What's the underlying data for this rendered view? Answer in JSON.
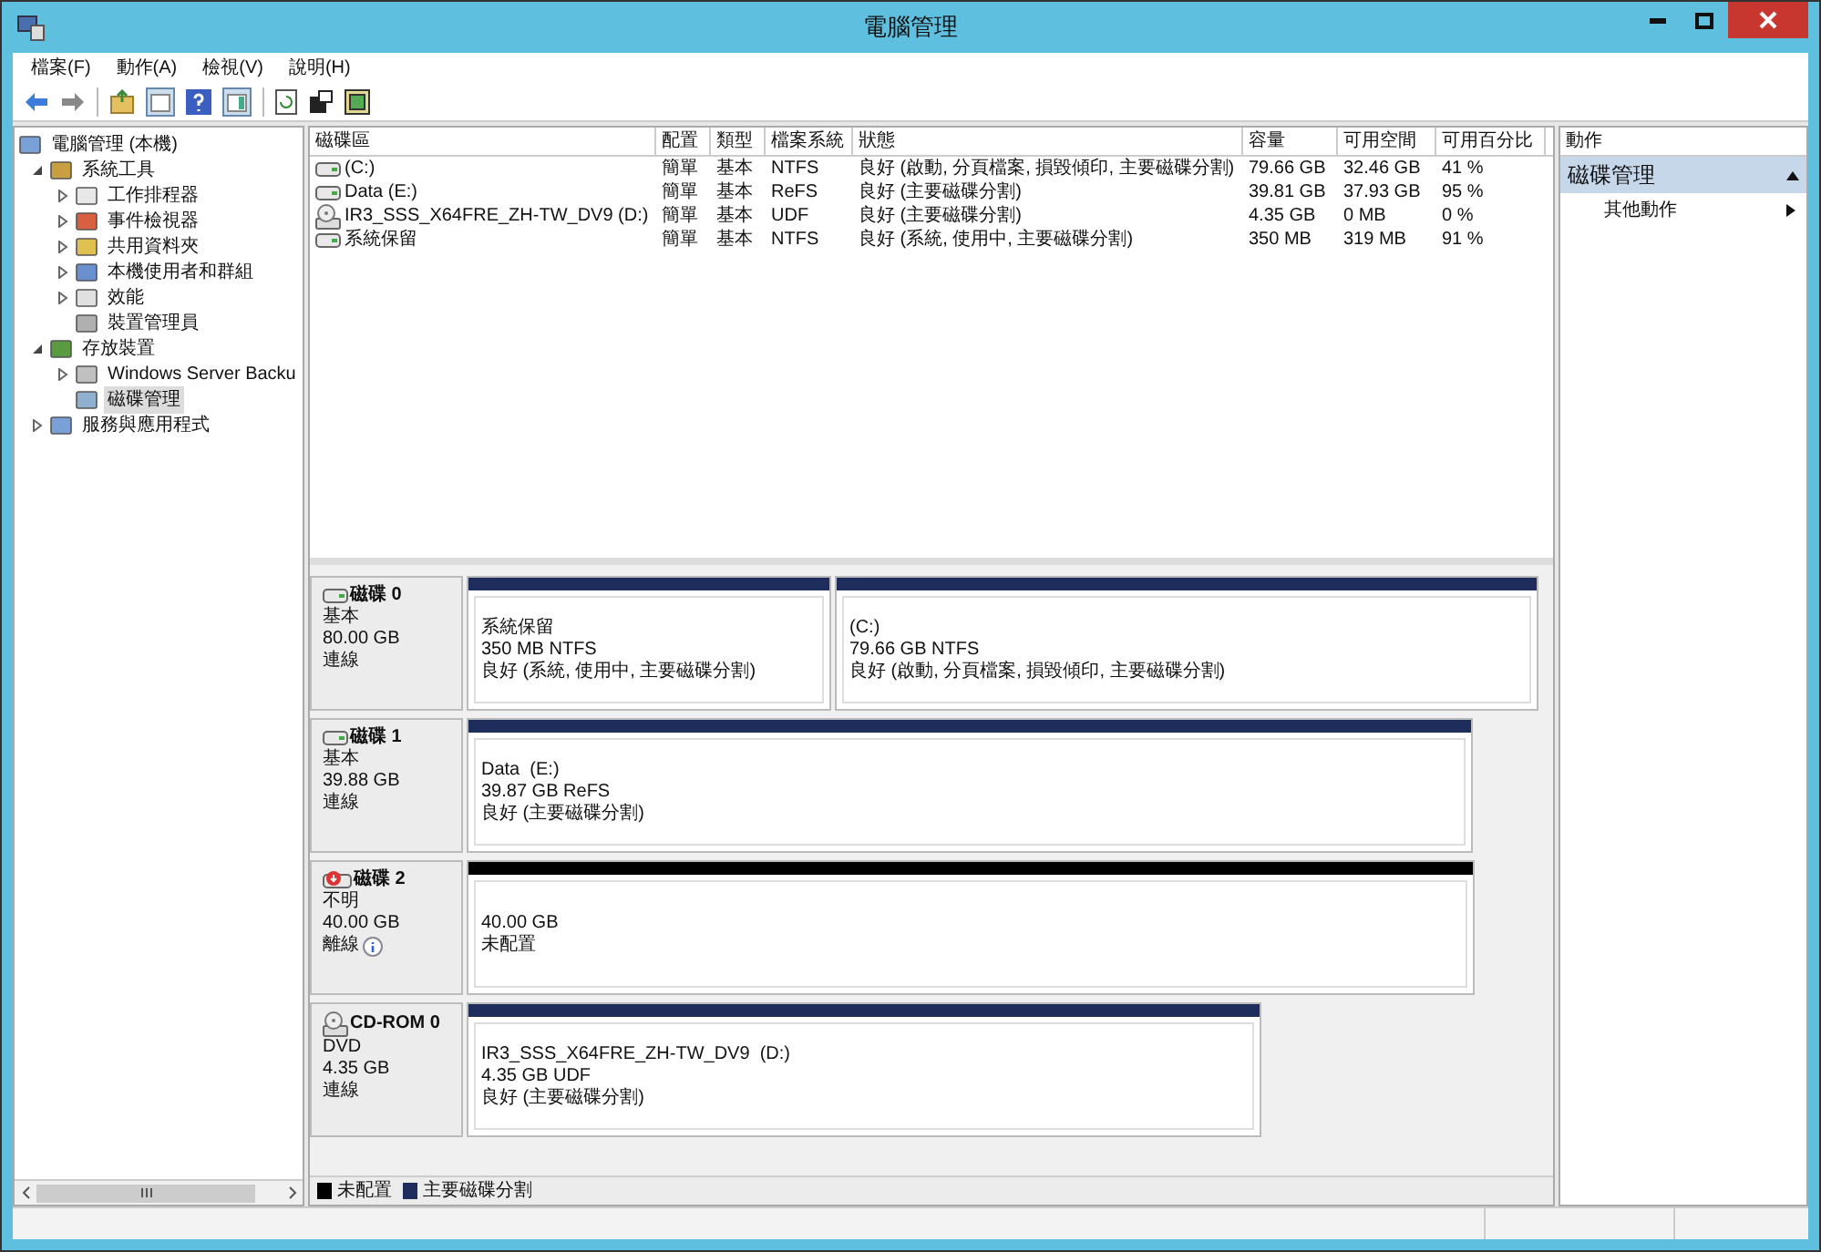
{
  "window": {
    "title": "電腦管理"
  },
  "menu": [
    "檔案(F)",
    "動作(A)",
    "檢視(V)",
    "說明(H)"
  ],
  "tree": [
    {
      "label": "電腦管理 (本機)",
      "selected": false,
      "children": [
        {
          "label": "系統工具",
          "selected": false,
          "expanded": true,
          "children": [
            {
              "label": "工作排程器",
              "selected": false,
              "expanded": false
            },
            {
              "label": "事件檢視器",
              "selected": false,
              "expanded": false
            },
            {
              "label": "共用資料夾",
              "selected": false,
              "expanded": false
            },
            {
              "label": "本機使用者和群組",
              "selected": false,
              "expanded": false
            },
            {
              "label": "效能",
              "selected": false,
              "expanded": false
            },
            {
              "label": "裝置管理員",
              "selected": false
            }
          ]
        },
        {
          "label": "存放裝置",
          "selected": false,
          "expanded": true,
          "children": [
            {
              "label": "Windows Server Backu",
              "selected": false,
              "expanded": false
            },
            {
              "label": "磁碟管理",
              "selected": true
            }
          ]
        },
        {
          "label": "服務與應用程式",
          "selected": false,
          "expanded": false
        }
      ]
    }
  ],
  "volumes": {
    "columns": [
      "磁碟區",
      "配置",
      "類型",
      "檔案系統",
      "狀態",
      "容量",
      "可用空間",
      "可用百分比"
    ],
    "rows": [
      {
        "kind": "disk",
        "cells": [
          "(C:)",
          "簡單",
          "基本",
          "NTFS",
          "良好 (啟動, 分頁檔案, 損毀傾印, 主要磁碟分割)",
          "79.66 GB",
          "32.46 GB",
          "41 %"
        ]
      },
      {
        "kind": "disk",
        "cells": [
          "Data (E:)",
          "簡單",
          "基本",
          "ReFS",
          "良好 (主要磁碟分割)",
          "39.81 GB",
          "37.93 GB",
          "95 %"
        ]
      },
      {
        "kind": "cd",
        "cells": [
          "IR3_SSS_X64FRE_ZH-TW_DV9 (D:)",
          "簡單",
          "基本",
          "UDF",
          "良好 (主要磁碟分割)",
          "4.35 GB",
          "0 MB",
          "0 %"
        ]
      },
      {
        "kind": "disk",
        "cells": [
          "系統保留",
          "簡單",
          "基本",
          "NTFS",
          "良好 (系統, 使用中, 主要磁碟分割)",
          "350 MB",
          "319 MB",
          "91 %"
        ]
      }
    ]
  },
  "disks": [
    {
      "kind": "disk",
      "name": "磁碟 0",
      "type": "基本",
      "size": "80.00 GB",
      "status": "連線",
      "partitions": [
        {
          "color": "#1f2d5c",
          "name": "系統保留",
          "size": "350 MB NTFS",
          "status": "良好 (系統, 使用中, 主要磁碟分割)"
        },
        {
          "color": "#1f2d5c",
          "name": "(C:)",
          "size": "79.66 GB NTFS",
          "status": "良好 (啟動, 分頁檔案, 損毀傾印, 主要磁碟分割)"
        }
      ]
    },
    {
      "kind": "disk",
      "name": "磁碟 1",
      "type": "基本",
      "size": "39.88 GB",
      "status": "連線",
      "partitions": [
        {
          "color": "#1f2d5c",
          "name": "Data  (E:)",
          "size": "39.87 GB ReFS",
          "status": "良好 (主要磁碟分割)"
        }
      ]
    },
    {
      "kind": "offline",
      "name": "磁碟 2",
      "type": "不明",
      "size": "40.00 GB",
      "status": "離線",
      "partitions": [
        {
          "color": "#000000",
          "size": "40.00 GB",
          "status": "未配置"
        }
      ]
    },
    {
      "kind": "cd",
      "name": "CD-ROM 0",
      "type": "DVD",
      "size": "4.35 GB",
      "status": "連線",
      "partitions": [
        {
          "color": "#1f2d5c",
          "name": "IR3_SSS_X64FRE_ZH-TW_DV9  (D:)",
          "size": "4.35 GB UDF",
          "status": "良好 (主要磁碟分割)"
        }
      ]
    }
  ],
  "legend": [
    {
      "label": "未配置",
      "color": "#000000"
    },
    {
      "label": "主要磁碟分割",
      "color": "#1f2d5c"
    }
  ],
  "actions": {
    "header": "動作",
    "section": {
      "label": "磁碟管理",
      "expanded": true
    },
    "items": [
      "其他動作"
    ]
  }
}
